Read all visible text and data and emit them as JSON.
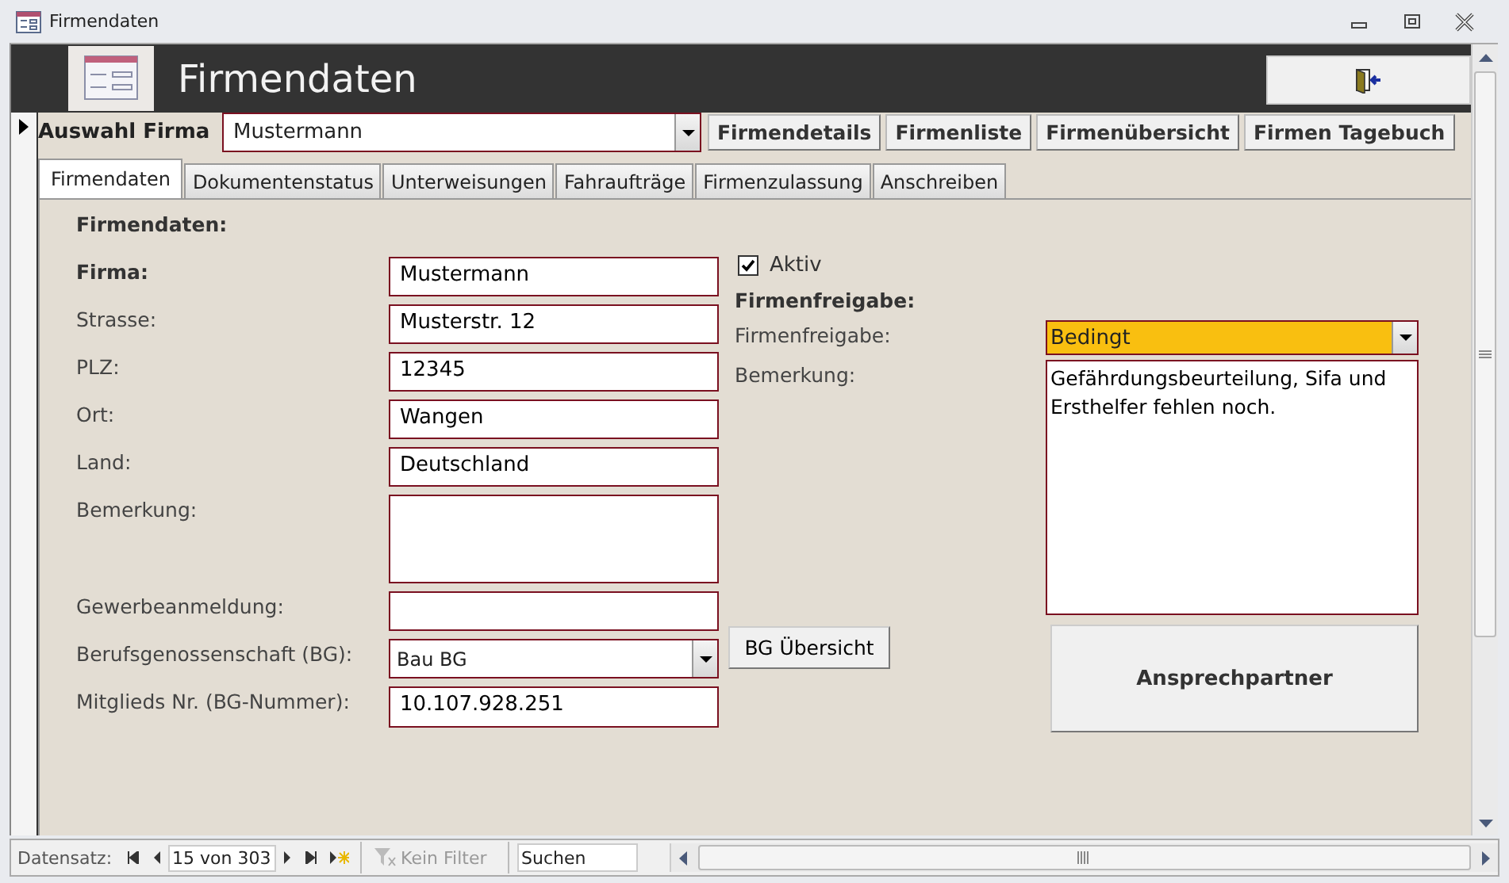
{
  "window": {
    "title": "Firmendaten"
  },
  "header": {
    "title": "Firmendaten"
  },
  "selector": {
    "label": "Auswahl Firma",
    "value": "Mustermann"
  },
  "nav_buttons": [
    "Firmendetails",
    "Firmenliste",
    "Firmenübersicht",
    "Firmen Tagebuch"
  ],
  "tabs": [
    {
      "label": "Firmendaten",
      "selected": true
    },
    {
      "label": "Dokumentenstatus",
      "selected": false
    },
    {
      "label": "Unterweisungen",
      "selected": false
    },
    {
      "label": "Fahraufträge",
      "selected": false
    },
    {
      "label": "Firmenzulassung",
      "selected": false
    },
    {
      "label": "Anschreiben",
      "selected": false
    }
  ],
  "section_title": "Firmendaten:",
  "fields": [
    {
      "label": "Firma:",
      "value": "Mustermann",
      "kind": "text",
      "bold": true
    },
    {
      "label": "Strasse:",
      "value": "Musterstr. 12",
      "kind": "text",
      "bold": false
    },
    {
      "label": "PLZ:",
      "value": "12345",
      "kind": "text",
      "bold": false
    },
    {
      "label": "Ort:",
      "value": "Wangen",
      "kind": "text",
      "bold": false
    },
    {
      "label": "Land:",
      "value": "Deutschland",
      "kind": "text",
      "bold": false
    },
    {
      "label": "Bemerkung:",
      "kind": "memo",
      "bold": false
    },
    {
      "label": "Gewerbeanmeldung:",
      "kind": "text",
      "bold": false
    },
    {
      "label": "Berufsgenossenschaft (BG):",
      "value": "Bau BG",
      "kind": "combo",
      "bold": false,
      "button": "BG Übersicht"
    },
    {
      "label": "Mitglieds Nr. (BG-Nummer):",
      "value": "10.107.928.251",
      "kind": "text",
      "bold": false
    }
  ],
  "active": {
    "label": "Aktiv",
    "checked": true
  },
  "release": {
    "title": "Firmenfreigabe:",
    "status_label": "Firmenfreigabe:",
    "status": "Bedingt",
    "remark_label": "Bemerkung:",
    "remark": "Gefährdungsbeurteilung, Sifa und Ersthelfer fehlen noch.",
    "contact_button": "Ansprechpartner"
  },
  "record_nav": {
    "label": "Datensatz:",
    "position": "15 von 303",
    "filter": "Kein Filter",
    "search_placeholder": "Suchen"
  }
}
